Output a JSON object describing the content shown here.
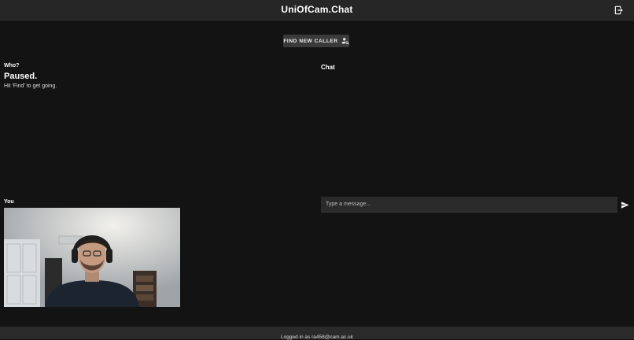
{
  "header": {
    "title": "UniOfCam.Chat",
    "logout_icon": "logout-icon"
  },
  "toolbar": {
    "find_label": "FIND NEW CALLER",
    "find_icon": "person-search-icon"
  },
  "status": {
    "who_label": "Who?",
    "title": "Paused.",
    "hint": "Hit 'Find' to get going."
  },
  "chat": {
    "label": "Chat",
    "input_placeholder": "Type a message...",
    "input_value": "",
    "send_icon": "send-icon"
  },
  "self_view": {
    "label": "You"
  },
  "footer": {
    "text": "Logged in as ra458@cam.ac.uk"
  },
  "colors": {
    "background": "#131313",
    "topbar": "#262626",
    "button": "#3a3a3a",
    "input": "#2a2a2a"
  }
}
